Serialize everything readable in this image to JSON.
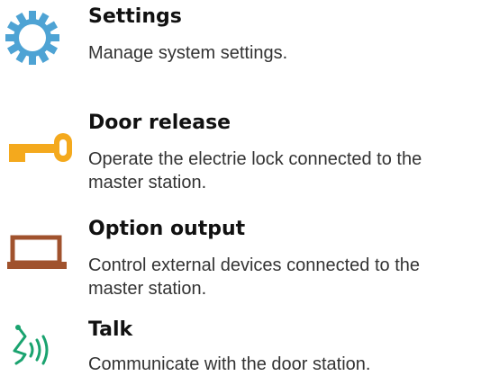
{
  "items": [
    {
      "id": "settings",
      "icon": "gear-icon",
      "icon_color": "#4ea3d4",
      "title": "Settings",
      "description": "Manage system settings."
    },
    {
      "id": "door-release",
      "icon": "key-icon",
      "icon_color": "#f4a91d",
      "title": "Door release",
      "description": "Operate the electrie lock connected to the master station."
    },
    {
      "id": "option-output",
      "icon": "laptop-icon",
      "icon_color": "#a0522d",
      "title": "Option output",
      "description": "Control external devices connected to the master station."
    },
    {
      "id": "talk",
      "icon": "talk-icon",
      "icon_color": "#1aa36f",
      "title": "Talk",
      "description": "Communicate with the door station."
    }
  ]
}
